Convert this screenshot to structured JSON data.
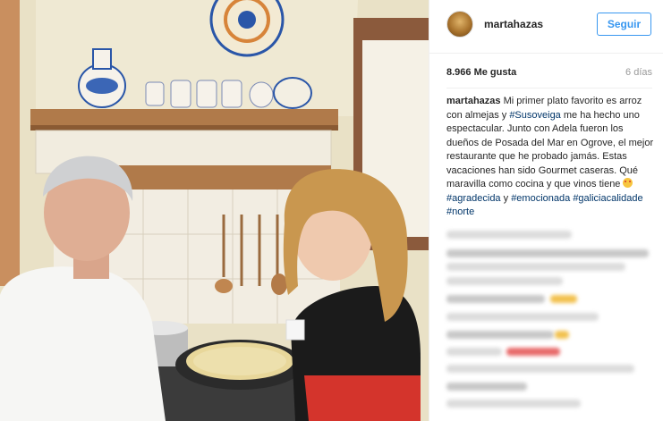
{
  "post": {
    "username": "martahazas",
    "follow_label": "Seguir",
    "likes": "8.966 Me gusta",
    "age": "6 días"
  },
  "caption": {
    "username": "martahazas",
    "segments": [
      {
        "t": " Mi primer plato favorito es arroz con almejas y "
      },
      {
        "tag": "#Susoveiga"
      },
      {
        "t": " me ha hecho uno espectacular. Junto con Adela fueron los dueños de Posada del Mar en Ogrove, el mejor restaurante que he probado jamás. Estas vacaciones han sido Gourmet caseras. Qué maravilla como cocina y que vinos tiene "
      },
      {
        "emoji": "smiling-face-heart-eyes"
      },
      {
        "t": " "
      },
      {
        "tag": "#agradecida"
      },
      {
        "t": " y "
      },
      {
        "tag": "#emocionada"
      },
      {
        "t": " "
      },
      {
        "tag": "#galiciacalidade"
      },
      {
        "t": " "
      },
      {
        "tag": "#norte"
      }
    ]
  },
  "colors": {
    "accent": "#3897f0",
    "hashtag": "#003569",
    "text": "#262626",
    "muted": "#999999"
  }
}
